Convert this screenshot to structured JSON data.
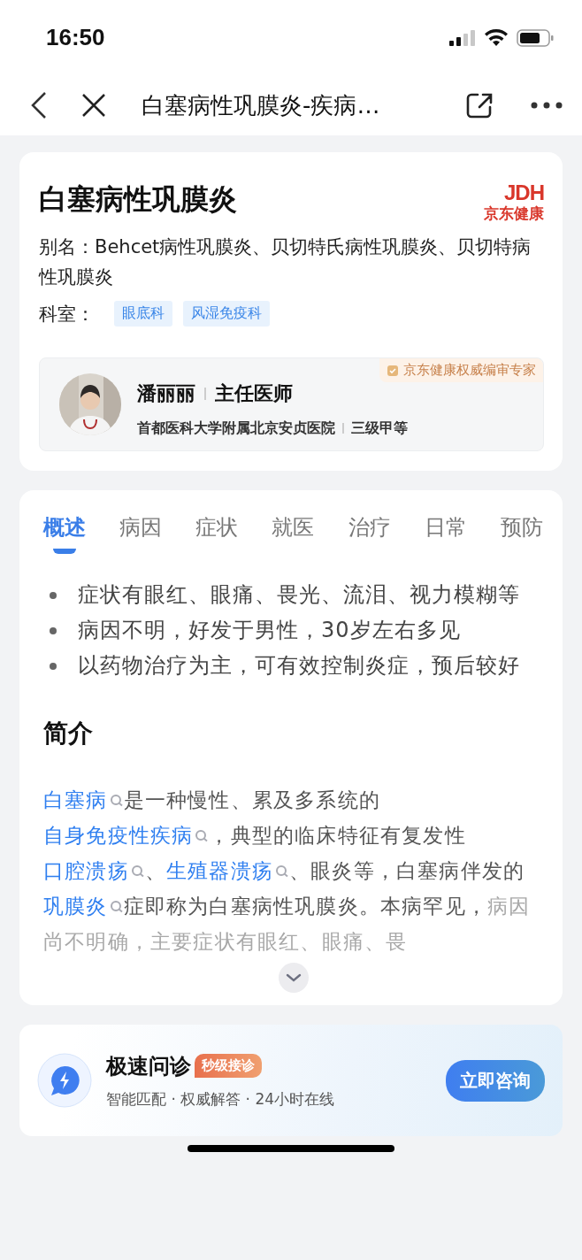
{
  "status_bar": {
    "time": "16:50"
  },
  "nav": {
    "title": "白塞病性巩膜炎-疾病…"
  },
  "disease": {
    "name": "白塞病性巩膜炎",
    "brand_mark": "JDH",
    "brand_name": "京东健康",
    "alias": "别名：Behcet病性巩膜炎、贝切特氏病性巩膜炎、贝切特病性巩膜炎",
    "department_label": "科室：",
    "departments": [
      "眼底科",
      "风湿免疫科"
    ]
  },
  "expert": {
    "badge": "京东健康权威编审专家",
    "name": "潘丽丽",
    "title": "主任医师",
    "hospital": "首都医科大学附属北京安贞医院",
    "grade": "三级甲等"
  },
  "tabs": [
    {
      "label": "概述",
      "selected": true
    },
    {
      "label": "病因",
      "selected": false
    },
    {
      "label": "症状",
      "selected": false
    },
    {
      "label": "就医",
      "selected": false
    },
    {
      "label": "治疗",
      "selected": false
    },
    {
      "label": "日常",
      "selected": false
    },
    {
      "label": "预防",
      "selected": false
    }
  ],
  "summary": [
    "症状有眼红、眼痛、畏光、流泪、视力模糊等",
    "病因不明，好发于男性，30岁左右多见",
    "以药物治疗为主，可有效控制炎症，预后较好"
  ],
  "intro": {
    "heading": "简介",
    "segments": [
      {
        "kind": "link",
        "text": "白塞病"
      },
      {
        "kind": "text",
        "text": "是一种慢性、累及多系统的"
      },
      {
        "kind": "link",
        "text": "自身免疫性疾病"
      },
      {
        "kind": "text",
        "text": "，典型的临床特征有复发性"
      },
      {
        "kind": "link",
        "text": "口腔溃疡"
      },
      {
        "kind": "text",
        "text": "、"
      },
      {
        "kind": "link",
        "text": "生殖器溃疡"
      },
      {
        "kind": "text",
        "text": "、眼炎等，白塞病伴发的"
      },
      {
        "kind": "link",
        "text": "巩膜炎"
      },
      {
        "kind": "text",
        "text": "症即称为白塞病性巩膜炎。本病罕见，"
      },
      {
        "kind": "faded",
        "text": "病因尚不明确，主要症状有眼红、眼痛、畏"
      }
    ]
  },
  "consult": {
    "title": "极速问诊",
    "tag": "秒级接诊",
    "features": "智能匹配 · 权威解答 · 24小时在线",
    "button": "立即咨询"
  }
}
